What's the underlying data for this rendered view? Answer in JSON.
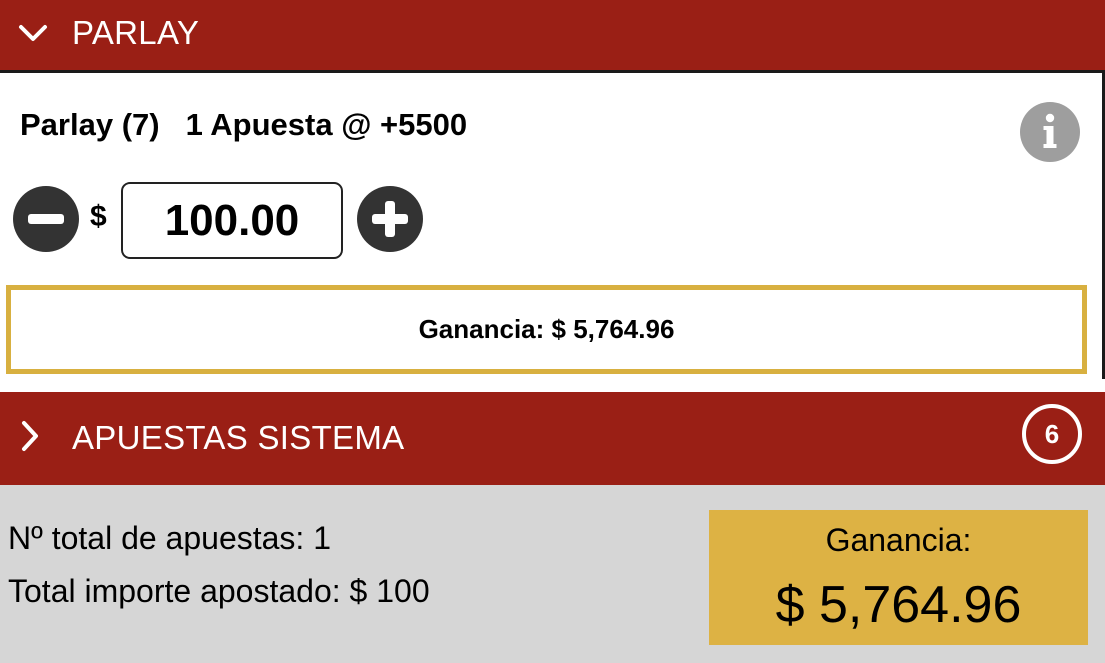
{
  "parlay_section": {
    "title": "PARLAY",
    "expanded_icon": "chevron-down-icon",
    "bet_label": "Parlay (7)",
    "bet_odds": "1 Apuesta @ +5500",
    "info_icon": "info-icon",
    "currency_symbol": "$",
    "stake_value": "100.00",
    "ganancia_text": "Ganancia: $ 5,764.96"
  },
  "system_section": {
    "title": "APUESTAS SISTEMA",
    "collapsed_icon": "chevron-right-icon",
    "count": "6"
  },
  "summary": {
    "total_bets_label": "Nº total de apuestas:",
    "total_bets_value": "1",
    "total_stake_label": "Total importe apostado:",
    "total_stake_value": "$ 100",
    "payout_label": "Ganancia:",
    "payout_value": "$ 5,764.96"
  },
  "colors": {
    "header_red": "#9a1f15",
    "gold_border": "#d8b040",
    "gold_fill": "#ddb244",
    "summary_gray": "#d6d6d6",
    "stepper_dark": "#333333",
    "info_gray": "#9e9e9e"
  }
}
